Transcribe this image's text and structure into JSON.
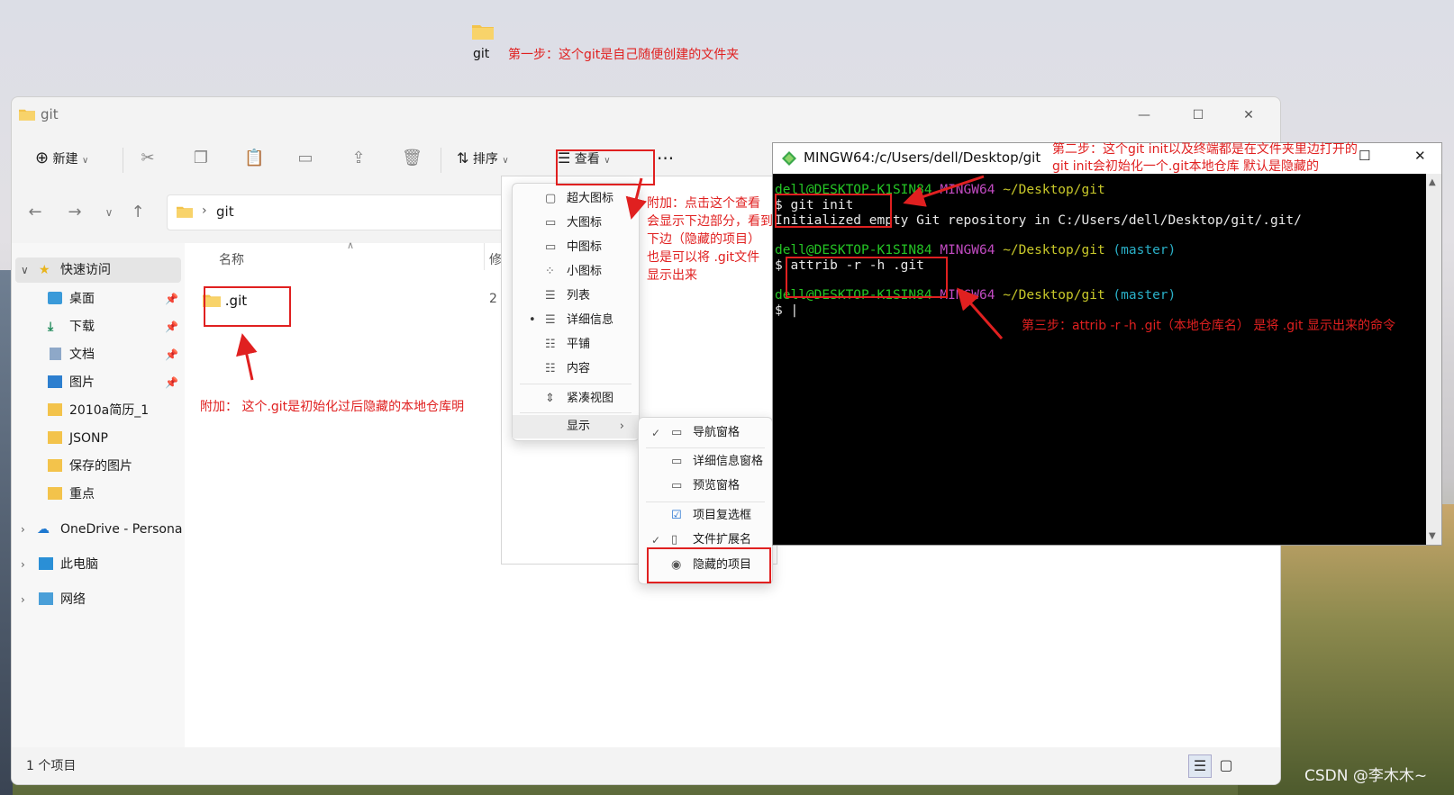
{
  "desktop": {
    "folder_label": "git",
    "step1": "第一步：这个git是自己随便创建的文件夹"
  },
  "explorer": {
    "title": "git",
    "window_controls": {
      "minimize": "—",
      "maximize": "☐",
      "close": "✕"
    },
    "toolbar": {
      "new_label": "新建",
      "sort_label": "排序",
      "view_label": "查看",
      "more_label": "···",
      "icons": [
        "cut-icon",
        "copy-icon",
        "paste-icon",
        "rename-icon",
        "share-icon",
        "delete-icon"
      ]
    },
    "address": {
      "path": "git",
      "separator": "›"
    },
    "sidebar": {
      "quick_access": "快速访问",
      "items": [
        {
          "label": "桌面",
          "icon": "desktop-icon",
          "pinned": true
        },
        {
          "label": "下载",
          "icon": "download-icon",
          "pinned": true
        },
        {
          "label": "文档",
          "icon": "document-icon",
          "pinned": true
        },
        {
          "label": "图片",
          "icon": "picture-icon",
          "pinned": true
        },
        {
          "label": "2010a简历_1",
          "icon": "folder-icon",
          "pinned": false
        },
        {
          "label": "JSONP",
          "icon": "folder-icon",
          "pinned": false
        },
        {
          "label": "保存的图片",
          "icon": "folder-icon",
          "pinned": false
        },
        {
          "label": "重点",
          "icon": "folder-icon",
          "pinned": false
        }
      ],
      "onedrive": "OneDrive - Persona",
      "this_pc": "此电脑",
      "network": "网络"
    },
    "columns": {
      "name": "名称",
      "modified_partial": "修"
    },
    "files": [
      {
        "name": ".git",
        "modified_partial": "2"
      }
    ],
    "status": {
      "count": "1 个项目"
    }
  },
  "view_menu": {
    "items": [
      {
        "label": "超大图标",
        "icon": "▢"
      },
      {
        "label": "大图标",
        "icon": "▭"
      },
      {
        "label": "中图标",
        "icon": "▭"
      },
      {
        "label": "小图标",
        "icon": "⁘"
      },
      {
        "label": "列表",
        "icon": "☰"
      },
      {
        "label": "详细信息",
        "icon": "☰",
        "selected": true
      },
      {
        "label": "平铺",
        "icon": "☷"
      },
      {
        "label": "内容",
        "icon": "☷"
      }
    ],
    "compact": "紧凑视图",
    "show": "显示"
  },
  "show_menu": {
    "items": [
      {
        "label": "导航窗格",
        "checked": true
      },
      {
        "label": "详细信息窗格",
        "checked": false
      },
      {
        "label": "预览窗格",
        "checked": false
      },
      {
        "label": "项目复选框",
        "checked": false
      },
      {
        "label": "文件扩展名",
        "checked": true
      },
      {
        "label": "隐藏的项目",
        "checked": false
      }
    ]
  },
  "terminal": {
    "title": "MINGW64:/c/Users/dell/Desktop/git",
    "lines": {
      "p1_user": "dell@DESKTOP-K1SIN84",
      "p1_sys": "MINGW64",
      "p1_path": "~/Desktop/git",
      "cmd1": "$ git init",
      "out1": "Initialized empty Git repository in C:/Users/dell/Desktop/git/.git/",
      "p2_user": "dell@DESKTOP-K1SIN84",
      "p2_sys": "MINGW64",
      "p2_path": "~/Desktop/git",
      "p2_branch": "(master)",
      "cmd2": "$ attrib -r -h .git",
      "p3_user": "dell@DESKTOP-K1SIN84",
      "p3_sys": "MINGW64",
      "p3_path": "~/Desktop/git",
      "p3_branch": "(master)",
      "cmd3": "$ |"
    }
  },
  "annotations": {
    "step2_line1": "第二步：这个git init以及终端都是在文件夹里边打开的",
    "step2_line2": "git init会初始化一个.git本地仓库 默认是隐藏的",
    "addon_view_1": "附加：点击这个查看",
    "addon_view_2": "会显示下边部分，看到",
    "addon_view_3": "下边（隐藏的项目）",
    "addon_view_4": "也是可以将 .git文件",
    "addon_view_5": "显示出来",
    "addon_git": "附加： 这个.git是初始化过后隐藏的本地仓库明",
    "step3": "第三步：attrib -r -h .git（本地仓库名） 是将 .git 显示出来的命令"
  },
  "watermark": "CSDN @李木木~",
  "colors": {
    "annotation_red": "#e02020",
    "terminal_green": "#25c525",
    "terminal_magenta": "#c14bc1",
    "terminal_yellow": "#c8c82a",
    "terminal_cyan": "#2ab0c8",
    "folder_yellow": "#f3c34b"
  }
}
